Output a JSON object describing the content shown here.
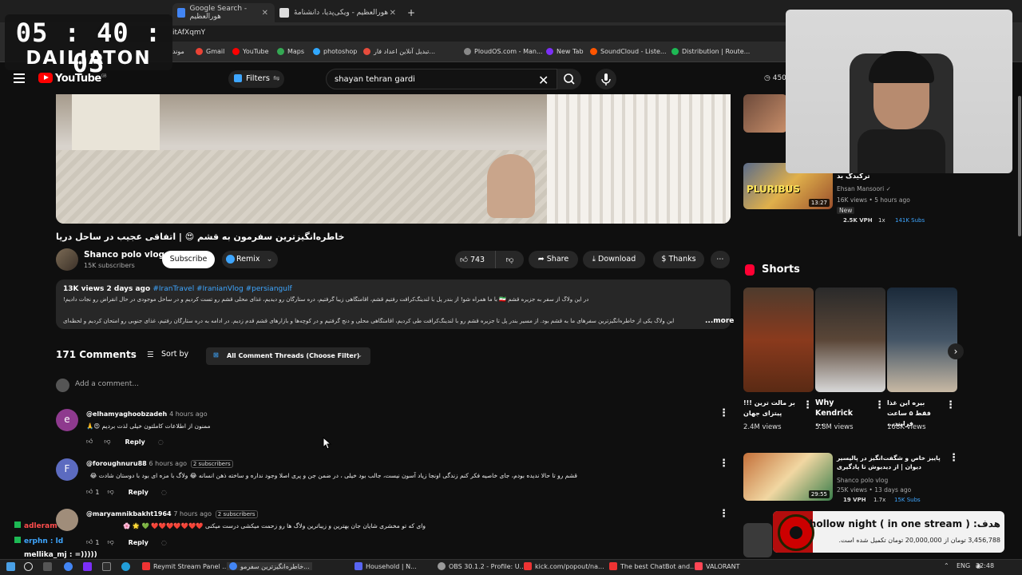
{
  "browser": {
    "tabs": [
      {
        "label": "Google Search - هورالعظیم",
        "close": "✕"
      },
      {
        "label": "هورالعظیم - ویکی‌پدیا، دانشنامهٔ",
        "close": "✕"
      }
    ],
    "new_tab": "+",
    "address_partial": "itAfXqmY",
    "bookmarks": [
      "موند",
      "Gmail",
      "YouTube",
      "Maps",
      "photoshop",
      "تبدیل آنلاین اعداد فار...",
      "PloudOS.com - Man...",
      "New Tab",
      "SoundCloud - Liste...",
      "Distribution | Route..."
    ]
  },
  "overlay_timer": {
    "time": "05 : 40 : 03",
    "label": "DAILIATON"
  },
  "youtube": {
    "logo_text": "YouTube",
    "logo_region": "GB",
    "filters_label": "Filters",
    "search_value": "shayan tehran gardi",
    "right_count": "450"
  },
  "video": {
    "title": "خاطره‌انگیزترین سفرمون به قشم 😍 | اتفاقی عجیب در ساحل دریا",
    "channel_name": "Shanco polo vlog",
    "channel_subs": "15K subscribers",
    "subscribe_label": "Subscribe",
    "remix_label": "Remix",
    "likes": "743",
    "share_label": "Share",
    "download_label": "Download",
    "thanks_label": "Thanks",
    "desc_meta": "13K views  2 days ago",
    "desc_tags": "#IranTravel #IranianVlog #persiangulf",
    "desc_line1": "در این ولاگ از سفر به جزیره قشم 🇮🇷 با ما همراه شو! از بندر پل با لندینگ‌کرافت رفتیم قشم، اقامتگاهی زیبا گرفتیم، دره ستارگان رو دیدیم، غذای محلی قشم رو تست کردیم و در ساحل موجودی در حال انقراض رو نجات دادیم!",
    "desc_line2": "این ولاگ یکی از خاطره‌انگیزترین سفرهای ما به قشم بود. از مسیر بندر پل تا جزیره قشم رو با لندینگ‌کرافت طی کردیم، اقامتگاهی محلی و دنج گرفتیم و در کوچه‌ها و بازارهای قشم قدم زدیم. در ادامه به دره ستارگان رفتیم، غذای جنوبی رو امتحان کردیم و لحظه‌ای",
    "more_label": "...more"
  },
  "comments": {
    "count_label": "171 Comments",
    "sort_label": "Sort by",
    "filter_label": "All Comment Threads (Choose Filter)",
    "add_placeholder": "Add a comment...",
    "reply_label": "Reply",
    "items": [
      {
        "initial": "e",
        "user": "@elhamyaghoobzadeh",
        "ago": "4 hours ago",
        "badge": "",
        "text": "ممنون از اطلاعات کاملتون خیلی لذت بردیم 😍🙏",
        "likes": ""
      },
      {
        "initial": "F",
        "user": "@foroughnuru88",
        "ago": "6 hours ago",
        "badge": "2 subscribers",
        "text": "قشم رو تا حالا ندیده بودم، جای خاصیه فکر کنم زندگی اونجا زیاد آسون نیست، جالب بود خیلی ، در ضمن جن و پری اصلا وجود نداره و ساخته ذهن انسانه 😂 ولاگ با مزه ای بود با دوستان شادت 😂",
        "likes": "1"
      },
      {
        "initial": "",
        "user": "@maryamnikbakht1964",
        "ago": "7 hours ago",
        "badge": "2 subscribers",
        "text": "وای که تو مخشری شایان جان بهترین و زیباترین ولاگ ها رو زحمت میکشی درست میکنی ❤️❤️❤️❤️❤️❤️❤️ 💚 🌟 🌸",
        "likes": "1"
      }
    ]
  },
  "sidebar": {
    "top_video": {
      "title": "ترکیدگ بد",
      "channel": "Ehsan Mansoori",
      "meta": "16K views • 5 hours ago",
      "badge": "New",
      "duration": "13:27",
      "thumb_text": "PLURIBUS",
      "vph": "2.5K VPH",
      "ratio": "1x",
      "subs": "141K Subs"
    },
    "shorts_label": "Shorts",
    "shorts": [
      {
        "title": "بر مالت ترین !!!پیتزای جهان",
        "views": "2.4M views"
      },
      {
        "title": "Why Kendrick ...",
        "views": "5.8M views"
      },
      {
        "title": "بیره این غذا فقط ۵ ساعت فرایند...",
        "views": "168K views"
      }
    ],
    "bottom_video": {
      "title": "پاییز خاص و شگفت‌انگیز در پالیسیر دیوان | از دیدیوش تا پادگیری",
      "channel": "Shanco polo vlog",
      "meta": "25K views • 13 days ago",
      "duration": "29:55",
      "vph": "19 VPH",
      "ratio": "1.7x",
      "subs": "15K Subs"
    }
  },
  "donation_goal": {
    "title": "هدف: hollow night ( in one stream )",
    "subtitle": "3,456,788 تومان از 20,000,000 تومان تکمیل شده است.",
    "progress": 0.173
  },
  "chat": [
    {
      "user": "adleram",
      "color": "#ff4d4d"
    },
    {
      "user": "erphn : ld",
      "color": "#3ea6ff"
    },
    {
      "user": "mellika_mj : =)))))",
      "color": "#ffffff"
    }
  ],
  "taskbar": {
    "items": [
      "Reymit Stream Panel ...",
      "خاطره‌انگیزترین سفرمو...",
      "Household | N...",
      "OBS 30.1.2 - Profile: U...",
      "kick.com/popout/na...",
      "The best ChatBot and...",
      "VALORANT"
    ],
    "lang": "ENG",
    "time": "22:48"
  },
  "colors": {
    "bg": "#0f0f0f",
    "accent": "#ff0000",
    "link": "#3ea6ff"
  }
}
